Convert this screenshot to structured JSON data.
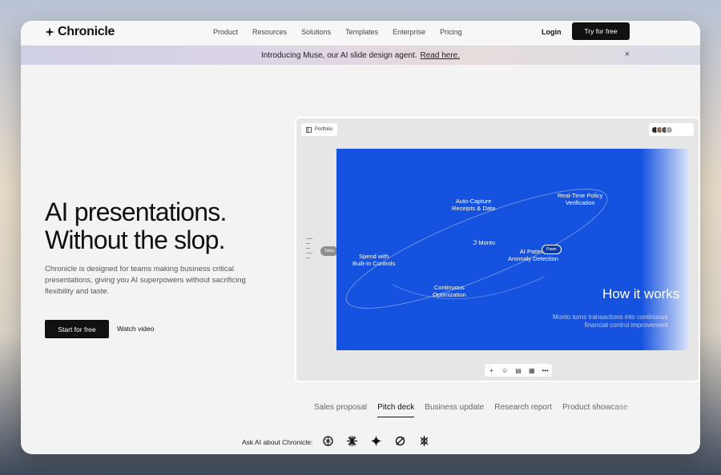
{
  "nav": {
    "logo": "Chronicle",
    "links": [
      "Product",
      "Resources",
      "Solutions",
      "Templates",
      "Enterprise",
      "Pricing"
    ],
    "login": "Login",
    "cta": "Try for free"
  },
  "banner": {
    "text": "Introducing Muse, our AI slide design agent.",
    "link": "Read here.",
    "close": "×"
  },
  "hero": {
    "title_line1": "AI presentations.",
    "title_line2": "Without the slop.",
    "description": "Chronicle is designed for teams making business critical presentations, giving you AI superpowers without sacrificing flexibility and taste.",
    "primary_button": "Start for free",
    "secondary_button": "Watch video"
  },
  "preview": {
    "chip_label": "Portfolio",
    "slide": {
      "label_spend": "Spend with\nBuilt-In Controls",
      "label_capture": "Auto-Capture\nReceipts & Data",
      "label_policy": "Real-Time Policy\nVerification",
      "label_brand": "Monto",
      "label_pattern": "AI Pattern\nAnomaly Detection",
      "label_optimization": "Continuous\nOptimization",
      "heading": "How it works",
      "subtext_line1": "Monto turns transactions into continuous",
      "subtext_line2": "financial control improvement",
      "bubble_left": "Taika",
      "bubble_right": "Pawn"
    },
    "toolbar": [
      "+",
      "☺",
      "▤",
      "▦",
      "•••"
    ]
  },
  "tabs": {
    "items": [
      "Sales proposal",
      "Pitch deck",
      "Business update",
      "Research report",
      "Product showcase"
    ],
    "active": "Pitch deck"
  },
  "ask_ai": {
    "label": "Ask AI about Chronicle:",
    "icons": [
      "openai-icon",
      "claude-icon",
      "gemini-icon",
      "perplexity-icon",
      "grok-icon"
    ]
  },
  "colors": {
    "slide_blue": "#1552e0",
    "button_dark": "#111111"
  }
}
